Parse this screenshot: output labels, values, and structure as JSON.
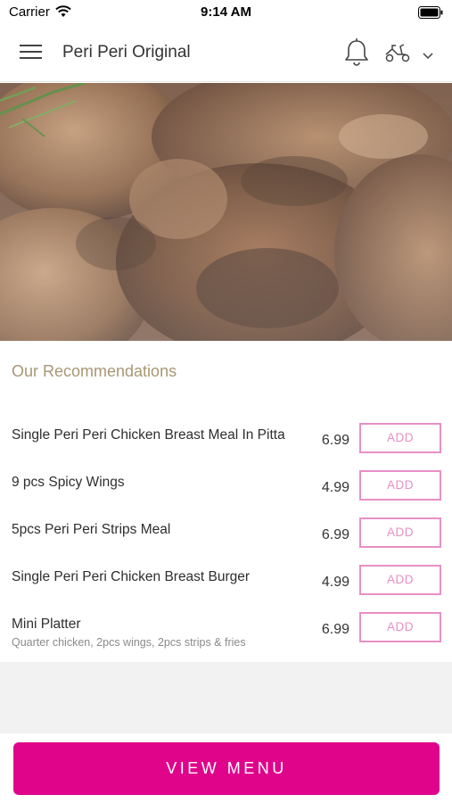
{
  "status_bar": {
    "carrier": "Carrier",
    "time": "9:14 AM"
  },
  "header": {
    "title": "Peri Peri Original",
    "icons": {
      "menu": "hamburger-menu-icon",
      "notifications": "bell-icon",
      "delivery": "scooter-icon",
      "dropdown": "chevron-down-icon"
    }
  },
  "hero": {
    "image": "grilled-peri-peri-chicken-photo"
  },
  "recommendations": {
    "title": "Our Recommendations",
    "items": [
      {
        "name": "Single Peri Peri Chicken Breast Meal In Pitta",
        "desc": "",
        "price": "6.99",
        "add": "ADD"
      },
      {
        "name": "9 pcs Spicy Wings",
        "desc": "",
        "price": "4.99",
        "add": "ADD"
      },
      {
        "name": "5pcs Peri Peri Strips Meal",
        "desc": "",
        "price": "6.99",
        "add": "ADD"
      },
      {
        "name": "Single Peri Peri Chicken Breast Burger",
        "desc": "",
        "price": "4.99",
        "add": "ADD"
      },
      {
        "name": "Mini Platter",
        "desc": "Quarter chicken, 2pcs wings, 2pcs strips & fries",
        "price": "6.99",
        "add": "ADD"
      }
    ]
  },
  "footer": {
    "view_menu": "VIEW MENU"
  },
  "colors": {
    "accent": "#e0048b",
    "add_border": "#e88fc6",
    "section_title": "#a89774"
  }
}
